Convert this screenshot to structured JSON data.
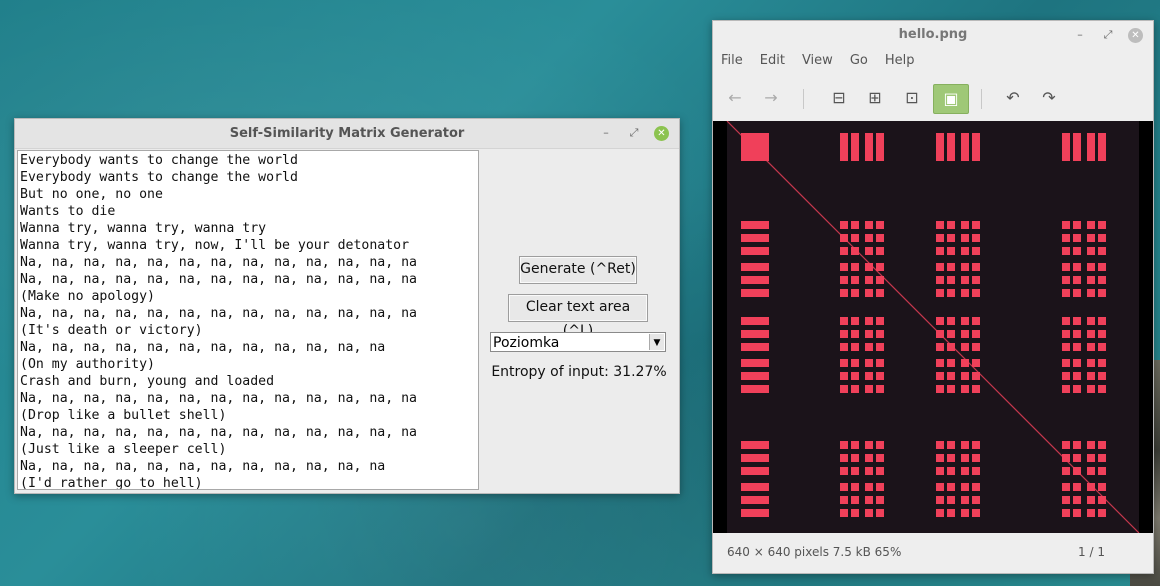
{
  "generator": {
    "title": "Self-Similarity Matrix Generator",
    "lines": [
      "Everybody wants to change the world",
      "Everybody wants to change the world",
      "But no one, no one",
      "Wants to die",
      "Wanna try, wanna try, wanna try",
      "Wanna try, wanna try, now, I'll be your detonator",
      "Na, na, na, na, na, na, na, na, na, na, na, na, na",
      "Na, na, na, na, na, na, na, na, na, na, na, na, na",
      "(Make no apology)",
      "Na, na, na, na, na, na, na, na, na, na, na, na, na",
      "(It's death or victory)",
      "Na, na, na, na, na, na, na, na, na, na, na, na",
      "(On my authority)",
      "Crash and burn, young and loaded",
      "Na, na, na, na, na, na, na, na, na, na, na, na, na",
      "(Drop like a bullet shell)",
      "Na, na, na, na, na, na, na, na, na, na, na, na, na",
      "(Just like a sleeper cell)",
      "Na, na, na, na, na, na, na, na, na, na, na, na",
      "(I'd rather go to hell)"
    ],
    "generate_label": "Generate (^Ret)",
    "clear_label": "Clear text area (^L)",
    "colormap_selected": "Poziomka",
    "entropy_text": "Entropy of input: 31.27%"
  },
  "viewer": {
    "title": "hello.png",
    "menu": [
      "File",
      "Edit",
      "View",
      "Go",
      "Help"
    ],
    "status_left": "640 × 640 pixels  7.5 kB   65%",
    "status_right": "1 / 1",
    "matrix_background": "#1b131a",
    "matrix_color": "#f0405a"
  },
  "colors": {
    "close_button": "#8cc350",
    "active_tool": "#9fc877"
  }
}
